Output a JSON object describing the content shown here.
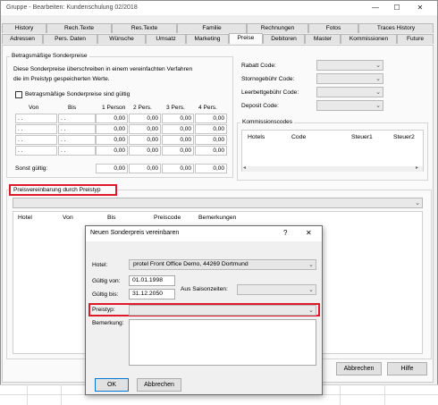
{
  "window": {
    "title": "Gruppe - Bearbeiten: Kundenschulung 02/2018"
  },
  "tabs_row1": [
    "History",
    "Rech.Texte",
    "Res.Texte",
    "Familie",
    "Rechnungen",
    "Fotos",
    "Traces History"
  ],
  "tabs_row2": [
    "Adressen",
    "Pers. Daten",
    "Wünsche",
    "Umsatz",
    "Marketing",
    "Preise",
    "Debitoren",
    "Master",
    "Kommissionen",
    "Future"
  ],
  "active_tab": "Preise",
  "special_prices": {
    "title": "Betragsmäßige Sonderpreise",
    "info_line1": "Diese Sonderpreise überschreiben in einem vereinfachten Verfahren",
    "info_line2": "die im Preistyp gespeicherten Werte.",
    "checkbox_label": "Betragsmäßige Sonderpreise sind gültig",
    "columns": [
      "Von",
      "Bis",
      "1 Person",
      "2 Pers.",
      "3 Pers.",
      "4 Pers."
    ],
    "rows": [
      [
        ". .",
        ". .",
        "0,00",
        "0,00",
        "0,00",
        "0,00"
      ],
      [
        ". .",
        ". .",
        "0,00",
        "0,00",
        "0,00",
        "0,00"
      ],
      [
        ". .",
        ". .",
        "0,00",
        "0,00",
        "0,00",
        "0,00"
      ],
      [
        ". .",
        ". .",
        "0,00",
        "0,00",
        "0,00",
        "0,00"
      ]
    ],
    "sonst_label": "Sonst gültig:",
    "sonst_values": [
      "0,00",
      "0,00",
      "0,00",
      "0,00"
    ]
  },
  "codes": {
    "rabatt": "Rabatt Code:",
    "storno": "Stornogebühr Code:",
    "leerbett": "Leerbettgebühr Code:",
    "deposit": "Deposit Code:"
  },
  "kommission": {
    "title": "Kommissionscodes",
    "columns": [
      "Hotels",
      "Code",
      "Steuer1",
      "Steuer2"
    ]
  },
  "preisvereinbarung": {
    "title": "Preisvereinbarung durch Preistyp",
    "columns": [
      "Hotel",
      "Von",
      "Bis",
      "Preiscode",
      "Bemerkungen"
    ]
  },
  "bottom_buttons": {
    "abbrechen": "Abbrechen",
    "hilfe": "Hilfe"
  },
  "dialog": {
    "title": "Neuen Sonderpreis vereinbaren",
    "help": "?",
    "close": "✕",
    "hotel_label": "Hotel:",
    "hotel_value": "protel Front Office Demo, 44269 Dortmund",
    "von_label": "Gültig von:",
    "von_value": "01.01.1998",
    "bis_label": "Gültig bis:",
    "bis_value": "31.12.2050",
    "saison_label": "Aus Saisonzeiten:",
    "preistyp_label": "Preistyp:",
    "bemerkung_label": "Bemerkung:",
    "ok": "OK",
    "abbrechen": "Abbrechen"
  },
  "colors": {
    "highlight": "#e0192a",
    "window_bg": "#f0f0f0",
    "panel_bg": "#fafafa"
  }
}
